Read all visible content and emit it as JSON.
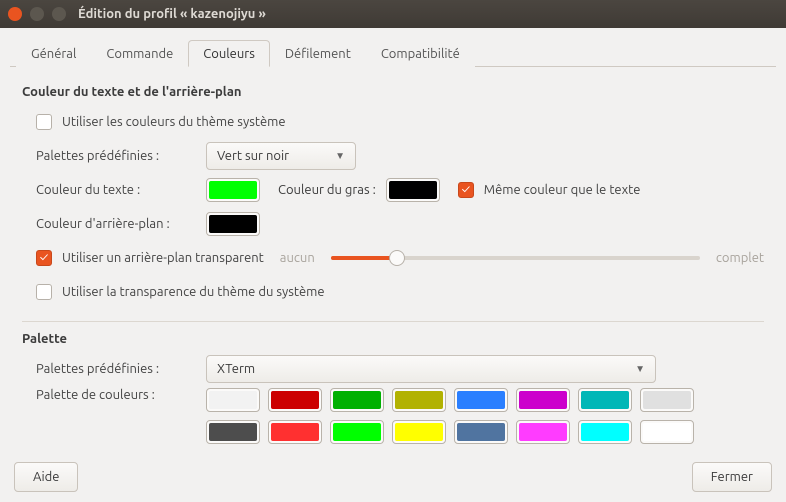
{
  "window": {
    "title": "Édition du profil « kazenojiyu »"
  },
  "tabs": {
    "general": "Général",
    "command": "Commande",
    "colors": "Couleurs",
    "scrolling": "Défilement",
    "compat": "Compatibilité"
  },
  "section_fgbg_title": "Couleur du texte et de l'arrière-plan",
  "use_theme_colors": {
    "label": "Utiliser les couleurs du thème système",
    "checked": false
  },
  "builtin_schemes": {
    "label": "Palettes prédéfinies :",
    "value": "Vert sur noir"
  },
  "text_color": {
    "label": "Couleur du texte :",
    "value": "#00ff00"
  },
  "bold_color": {
    "label": "Couleur du gras :",
    "value": "#000000"
  },
  "same_bold": {
    "label": "Même couleur que le texte",
    "checked": true
  },
  "bg_color": {
    "label": "Couleur d'arrière-plan :",
    "value": "#000000"
  },
  "transparent_bg": {
    "label": "Utiliser un arrière-plan transparent",
    "checked": true
  },
  "slider": {
    "min_label": "aucun",
    "max_label": "complet",
    "value_pct": 18
  },
  "use_theme_transparency": {
    "label": "Utiliser la transparence du thème du système",
    "checked": false
  },
  "section_palette_title": "Palette",
  "palette_scheme": {
    "label": "Palettes prédéfinies :",
    "value": "XTerm"
  },
  "palette_label": "Palette de couleurs :",
  "palette": [
    "#f2f2f2",
    "#cc0000",
    "#00b000",
    "#b2b200",
    "#2a7fff",
    "#cc00cc",
    "#00b7b7",
    "#e0e0e0",
    "#4d4d4d",
    "#ff3030",
    "#00ff00",
    "#ffff00",
    "#5074a0",
    "#ff3cff",
    "#00ffff",
    "#ffffff"
  ],
  "footer": {
    "help": "Aide",
    "close": "Fermer"
  }
}
